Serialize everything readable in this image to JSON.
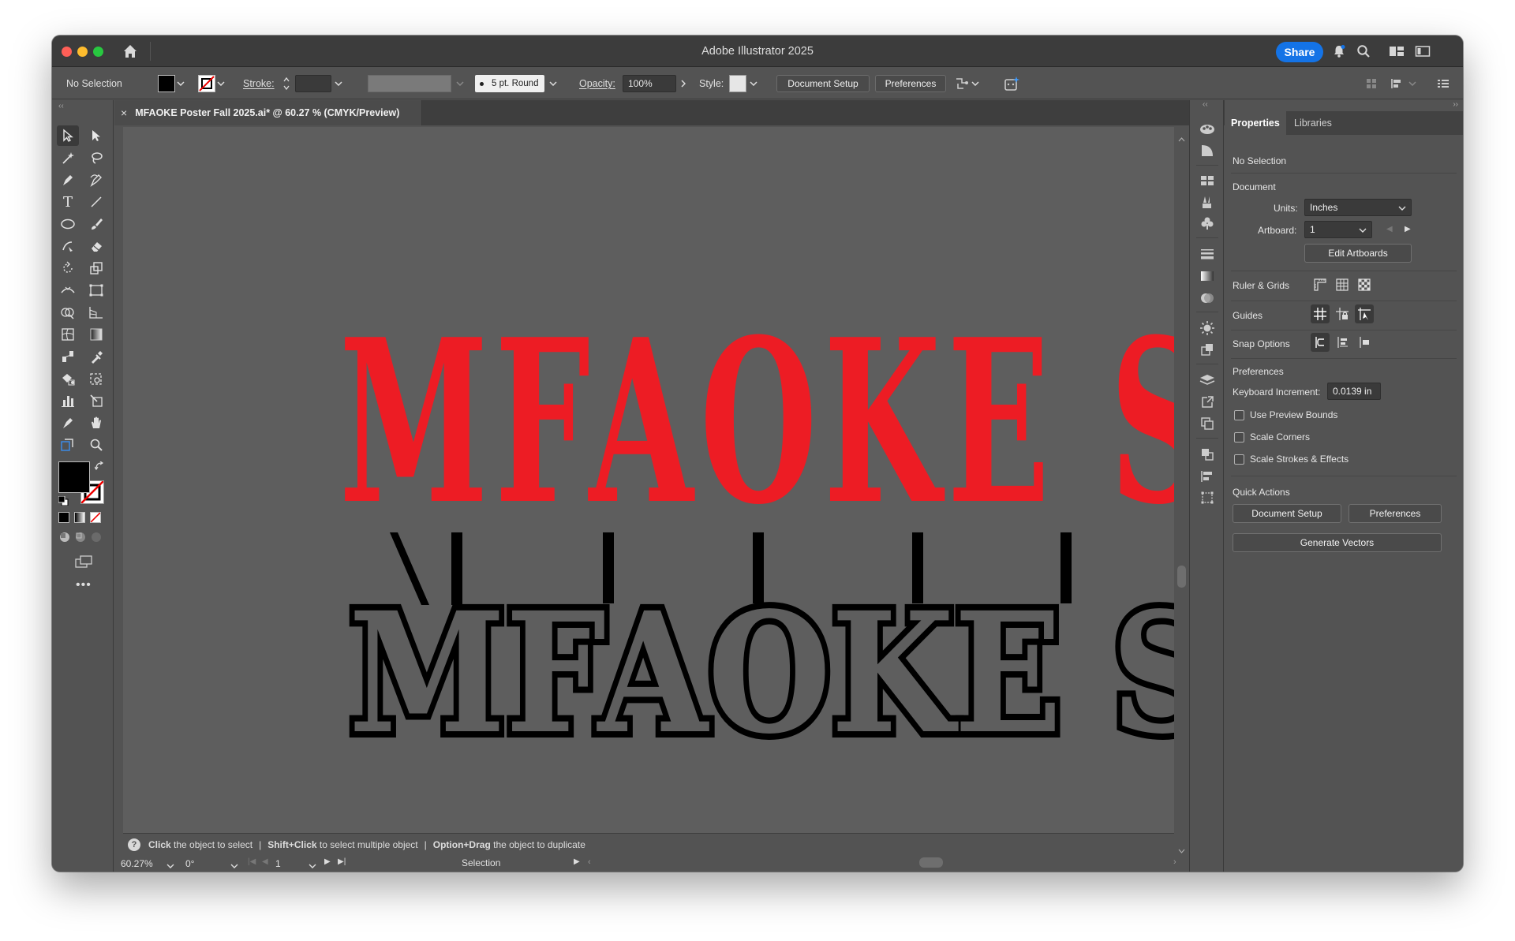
{
  "app": {
    "title": "Adobe Illustrator 2025",
    "share_label": "Share"
  },
  "controlbar": {
    "selection_state": "No Selection",
    "fill_color": "#000000",
    "stroke_label": "Stroke:",
    "stroke_weight": "",
    "brush_label": "5 pt. Round",
    "opacity_label": "Opacity:",
    "opacity_value": "100%",
    "style_label": "Style:",
    "document_setup_label": "Document Setup",
    "preferences_label": "Preferences"
  },
  "document": {
    "tab_title": "MFAOKE Poster Fall 2025.ai* @ 60.27 % (CMYK/Preview)",
    "close_glyph": "×"
  },
  "artwork": {
    "red_text": "MFAOKE S",
    "shadow_text": "MFAOKE S",
    "red_color": "#ed1c24",
    "shadow_color": "#000000"
  },
  "status": {
    "hint_parts": [
      {
        "bold": "Click",
        "text": " the object to select"
      },
      {
        "bold": "Shift+Click",
        "text": " to select multiple object"
      },
      {
        "bold": "Option+Drag",
        "text": " the object to duplicate"
      }
    ],
    "separator": "|",
    "zoom": "60.27%",
    "rotation": "0°",
    "artboard": "1",
    "tool_name": "Selection"
  },
  "properties": {
    "tab_properties": "Properties",
    "tab_libraries": "Libraries",
    "selection_state": "No Selection",
    "document_heading": "Document",
    "units_label": "Units:",
    "units_value": "Inches",
    "artboard_label": "Artboard:",
    "artboard_value": "1",
    "edit_artboards_label": "Edit Artboards",
    "ruler_grids_label": "Ruler & Grids",
    "guides_label": "Guides",
    "snap_options_label": "Snap Options",
    "preferences_heading": "Preferences",
    "keyboard_increment_label": "Keyboard Increment:",
    "keyboard_increment_value": "0.0139 in",
    "use_preview_bounds_label": "Use Preview Bounds",
    "scale_corners_label": "Scale Corners",
    "scale_strokes_label": "Scale Strokes & Effects",
    "quick_actions_heading": "Quick Actions",
    "qa_document_setup_label": "Document Setup",
    "qa_preferences_label": "Preferences",
    "qa_generate_vectors_label": "Generate Vectors"
  },
  "colors": {
    "accent_blue": "#1473e6",
    "panel_bg": "#535353",
    "canvas_bg": "#5e5e5e"
  }
}
